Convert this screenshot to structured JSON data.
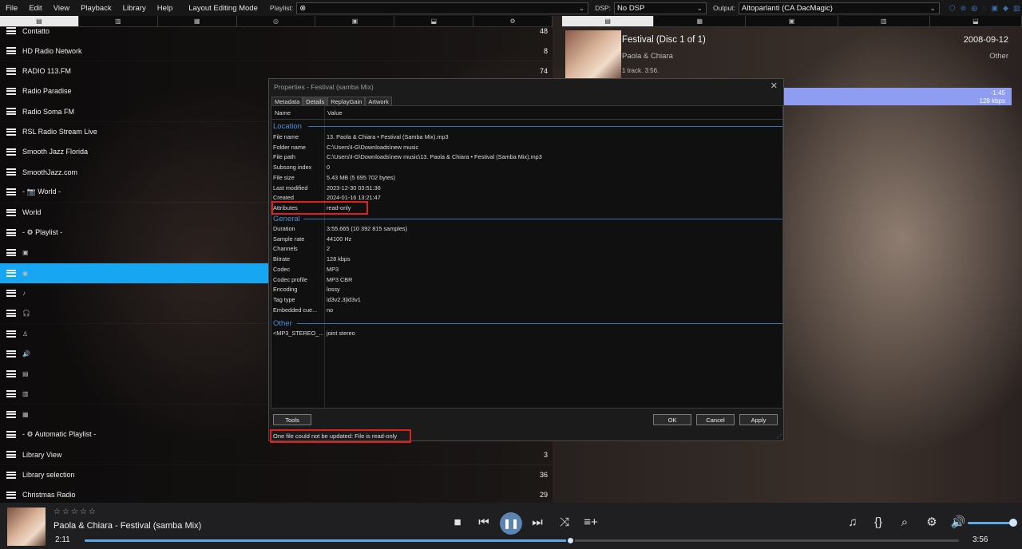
{
  "menu": {
    "items": [
      "File",
      "Edit",
      "View",
      "Playback",
      "Library",
      "Help"
    ],
    "layout_mode": "Layout Editing Mode",
    "playlist_label": "Playlist:",
    "playlist_value": "⊗",
    "dsp_label": "DSP:",
    "dsp_value": "No DSP",
    "output_label": "Output:",
    "output_value": "Altoparlanti (CA DacMagic)"
  },
  "left_tabs": [
    "▤",
    "▥",
    "▦",
    "◎",
    "▣",
    "⬓",
    "⚙"
  ],
  "right_tabs": [
    "▤",
    "▦",
    "▣",
    "▥",
    "⬓"
  ],
  "left_list": [
    {
      "label": "Contatto",
      "count": "48",
      "icon": ""
    },
    {
      "label": "HD Radio Network",
      "count": "8",
      "icon": ""
    },
    {
      "label": "RADIO 113.FM",
      "count": "74",
      "icon": ""
    },
    {
      "label": "Radio Paradise",
      "count": "",
      "icon": ""
    },
    {
      "label": "Radio Soma FM",
      "count": "",
      "icon": ""
    },
    {
      "label": "RSL Radio Stream Live",
      "count": "",
      "icon": ""
    },
    {
      "label": "Smooth Jazz Florida",
      "count": "",
      "icon": ""
    },
    {
      "label": "SmoothJazz.com",
      "count": "",
      "icon": ""
    },
    {
      "label": "- 📷 World -",
      "count": "",
      "icon": ""
    },
    {
      "label": "World",
      "count": "",
      "icon": ""
    },
    {
      "label": "- ⚙ Playlist -",
      "count": "",
      "icon": ""
    },
    {
      "label": "",
      "count": "",
      "icon": "▣"
    },
    {
      "label": "",
      "count": "",
      "icon": "◉"
    },
    {
      "label": "",
      "count": "",
      "icon": "♪"
    },
    {
      "label": "",
      "count": "",
      "icon": "🎧"
    },
    {
      "label": "",
      "count": "",
      "icon": "♙"
    },
    {
      "label": "",
      "count": "",
      "icon": "🔊"
    },
    {
      "label": "",
      "count": "",
      "icon": "▤"
    },
    {
      "label": "",
      "count": "",
      "icon": "▥"
    },
    {
      "label": "",
      "count": "",
      "icon": "▦"
    },
    {
      "label": "- ⚙ Automatic Playlist -",
      "count": "",
      "icon": ""
    },
    {
      "label": "Library View",
      "count": "3",
      "icon": ""
    },
    {
      "label": "Library selection",
      "count": "36",
      "icon": ""
    },
    {
      "label": "Christmas Radio",
      "count": "29",
      "icon": ""
    }
  ],
  "now_playing_panel": {
    "album": "Festival (Disc 1 of 1)",
    "artist": "Paola & Chiara",
    "info": "1 track. 3:56.",
    "date": "2008-09-12",
    "genre": "Other",
    "track_time": "-1:45",
    "track_bitrate": "128 kbps"
  },
  "dialog": {
    "title": "Properties - Festival (samba Mix)",
    "close": "✕",
    "tabs": [
      "Metadata",
      "Details",
      "ReplayGain",
      "Artwork"
    ],
    "col_name": "Name",
    "col_value": "Value",
    "sections": {
      "location": "Location",
      "general": "General",
      "other": "Other"
    },
    "location_rows": [
      {
        "k": "File name",
        "v": "13. Paola & Chiara • Festival (Samba Mix).mp3"
      },
      {
        "k": "Folder name",
        "v": "C:\\Users\\I-G\\Downloads\\new music"
      },
      {
        "k": "File path",
        "v": "C:\\Users\\I-G\\Downloads\\new music\\13. Paola & Chiara • Festival (Samba Mix).mp3"
      },
      {
        "k": "Subsong index",
        "v": "0"
      },
      {
        "k": "File size",
        "v": "5.43 MB (5 695 702 bytes)"
      },
      {
        "k": "Last modified",
        "v": "2023-12-30 03:51:36"
      },
      {
        "k": "Created",
        "v": "2024-01-16 13:21:47"
      },
      {
        "k": "Attributes",
        "v": "read-only"
      }
    ],
    "general_rows": [
      {
        "k": "Duration",
        "v": "3:55.665 (10 392 815 samples)"
      },
      {
        "k": "Sample rate",
        "v": "44100 Hz"
      },
      {
        "k": "Channels",
        "v": "2"
      },
      {
        "k": "Bitrate",
        "v": "128 kbps"
      },
      {
        "k": "Codec",
        "v": "MP3"
      },
      {
        "k": "Codec profile",
        "v": "MP3 CBR"
      },
      {
        "k": "Encoding",
        "v": "lossy"
      },
      {
        "k": "Tag type",
        "v": "id3v2.3|id3v1"
      },
      {
        "k": "Embedded cue...",
        "v": "no"
      }
    ],
    "other_rows": [
      {
        "k": "<MP3_STEREO_...",
        "v": "joint stereo"
      }
    ],
    "buttons": {
      "tools": "Tools",
      "ok": "OK",
      "cancel": "Cancel",
      "apply": "Apply"
    },
    "status": "One file could not be updated: File is read-only"
  },
  "player": {
    "stars": "☆☆☆☆☆",
    "title": "Paola & Chiara - Festival (samba Mix)",
    "elapsed": "2:11",
    "total": "3:56",
    "progress": 0.556,
    "volume": 0.95
  },
  "colors": {
    "selection": "#16a6f2",
    "highlight_border": "#e01f1f",
    "section_blue": "#4c8fd6"
  }
}
